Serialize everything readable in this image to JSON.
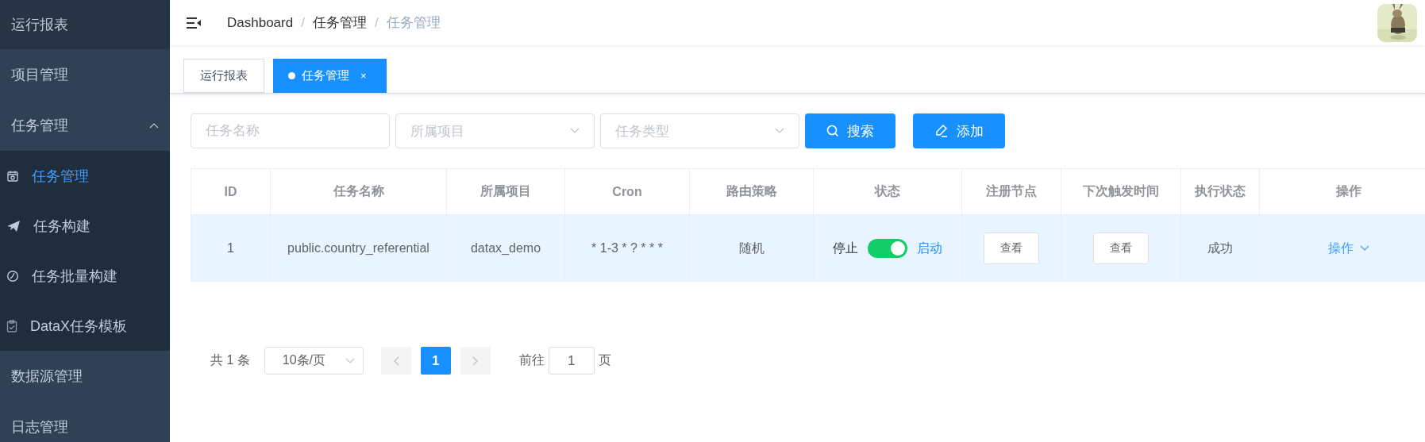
{
  "sidebar": {
    "items": [
      {
        "label": "运行报表",
        "selected": false
      },
      {
        "label": "项目管理",
        "selected": false
      },
      {
        "label": "任务管理",
        "selected": false,
        "expanded": true,
        "children": [
          {
            "label": "任务管理",
            "selected": true
          },
          {
            "label": "任务构建",
            "selected": false
          },
          {
            "label": "任务批量构建",
            "selected": false
          },
          {
            "label": "DataX任务模板",
            "selected": false
          }
        ]
      },
      {
        "label": "数据源管理",
        "selected": false
      },
      {
        "label": "日志管理",
        "selected": false
      }
    ]
  },
  "breadcrumb": {
    "separator": "/",
    "items": [
      "Dashboard",
      "任务管理",
      "任务管理"
    ]
  },
  "tabs": [
    {
      "label": "运行报表",
      "selected": false
    },
    {
      "label": "任务管理",
      "selected": true,
      "close": "×"
    }
  ],
  "filters": {
    "name": {
      "placeholder": "任务名称"
    },
    "project": {
      "placeholder": "所属项目"
    },
    "type": {
      "placeholder": "任务类型"
    },
    "buttons": [
      {
        "label": "搜索"
      },
      {
        "label": "添加"
      }
    ]
  },
  "table": {
    "columns": [
      "ID",
      "任务名称",
      "所属项目",
      "Cron",
      "路由策略",
      "状态",
      "注册节点",
      "下次触发时间",
      "执行状态",
      "操作"
    ],
    "rows": [
      {
        "selected": true,
        "id": "1",
        "name": "public.country_referential",
        "project": "datax_demo",
        "cron": "* 1-3 * ? * * *",
        "route": "随机",
        "status": {
          "off_label": "停止",
          "on_label": "启动",
          "on": true
        },
        "node": "查看",
        "next_trigger": "查看",
        "exec_status": "成功",
        "action": "操作"
      }
    ]
  },
  "pagination": {
    "total": "共 1 条",
    "page_size": "10条/页",
    "pages": [
      {
        "label": "1",
        "selected": true
      }
    ],
    "goto_label": "前往",
    "goto_value": "1",
    "goto_suffix": "页"
  }
}
